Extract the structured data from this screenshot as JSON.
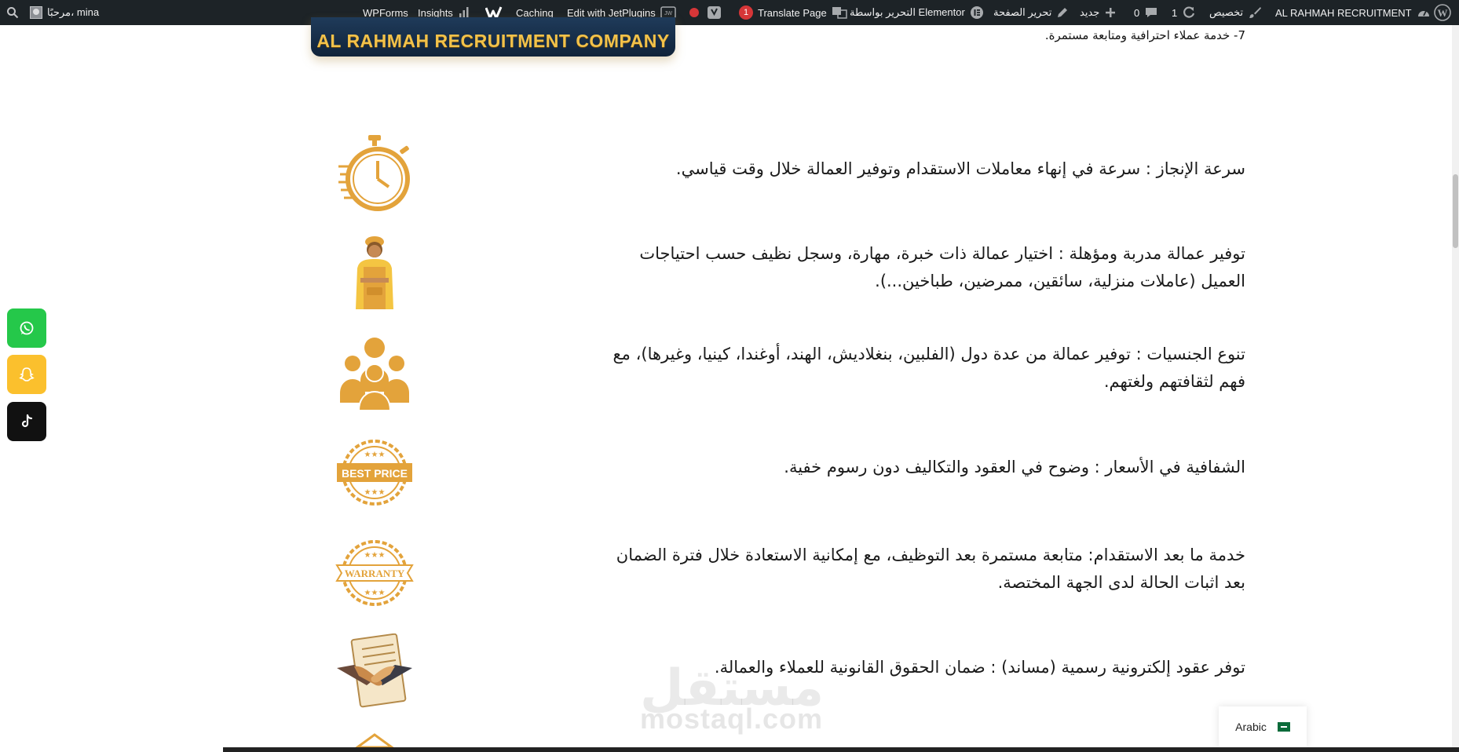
{
  "adminbar": {
    "site_name": "AL RAHMAH RECRUITMENT",
    "customize": "تخصيص",
    "updates_count": "1",
    "comments_count": "0",
    "new_label": "جديد",
    "edit_page": "تحرير الصفحة",
    "elementor_edit": "التحرير بواسطة Elementor",
    "translate_page": "Translate Page",
    "translate_badge": "1",
    "jetplugins": "Edit with JetPlugins",
    "caching": "Caching",
    "insights": "Insights",
    "wpforms": "WPForms",
    "greeting": "مرحبًا، mina"
  },
  "logo": {
    "text": "AL RAHMAH RECRUITMENT COMPANY"
  },
  "top_line": "7- خدمة عملاء احترافية ومتابعة مستمرة.",
  "features": [
    {
      "text": "سرعة الإنجاز : سرعة في إنهاء معاملات الاستقدام وتوفير العمالة خلال وقت قياسي.",
      "icon": "stopwatch-icon"
    },
    {
      "text": "توفير عمالة مدربة ومؤهلة : اختيار عمالة ذات خبرة، مهارة، وسجل نظيف حسب احتياجات العميل (عاملات منزلية، سائقين، ممرضين، طباخين...).",
      "icon": "worker-icon"
    },
    {
      "text": "تنوع الجنسيات : توفير عمالة من عدة دول (الفلبين، بنغلاديش، الهند، أوغندا، كينيا، وغيرها)، مع فهم لثقافتهم ولغتهم.",
      "icon": "people-group-icon"
    },
    {
      "text": "الشفافية في الأسعار : وضوح في العقود والتكاليف دون رسوم خفية.",
      "icon": "best-price-badge-icon",
      "badge_text": "BEST PRICE"
    },
    {
      "text": "خدمة ما بعد الاستقدام: متابعة مستمرة بعد التوظيف، مع إمكانية الاستعادة خلال فترة الضمان بعد اثبات الحالة لدى الجهة المختصة.",
      "icon": "warranty-badge-icon",
      "badge_text": "WARRANTY"
    },
    {
      "text": "توفر عقود إلكترونية رسمية (مساند) : ضمان الحقوق القانونية للعملاء والعمالة.",
      "icon": "handshake-contract-icon"
    }
  ],
  "social": {
    "whatsapp_color": "#25c84a",
    "snapchat_color": "#fbc02d",
    "tiktok_color": "#111111"
  },
  "watermark": {
    "arabic": "مستقل",
    "latin": "mostaql.com"
  },
  "language_switcher": {
    "label": "Arabic"
  },
  "colors": {
    "adminbar_bg": "#1d2327",
    "icon_gold": "#e3a33b"
  }
}
